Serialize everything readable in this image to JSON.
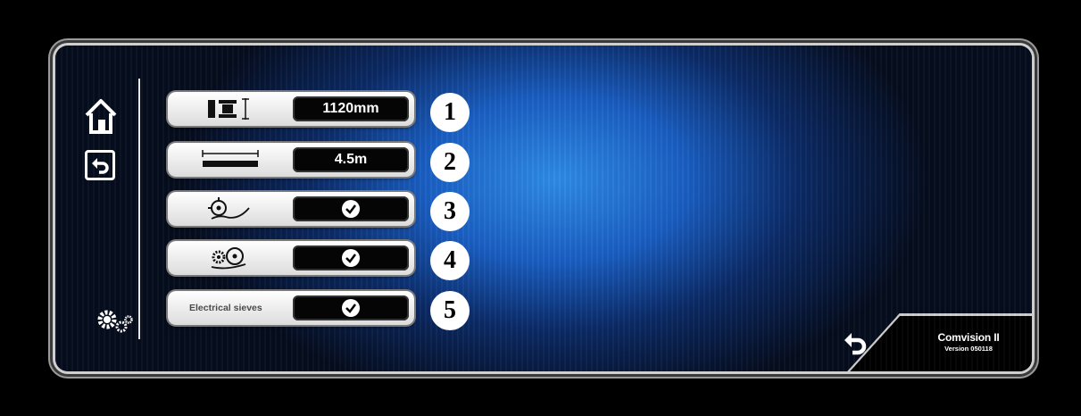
{
  "rows": [
    {
      "number": "1",
      "icon": "spacing-icon",
      "value": "1120mm",
      "type": "text"
    },
    {
      "number": "2",
      "icon": "width-icon",
      "value": "4.5m",
      "type": "text"
    },
    {
      "number": "3",
      "icon": "rotor-icon",
      "value": "",
      "type": "check"
    },
    {
      "number": "4",
      "icon": "gears-sieve-icon",
      "value": "",
      "type": "check"
    },
    {
      "number": "5",
      "label": "Electrical sieves",
      "value": "",
      "type": "check"
    }
  ],
  "brand": {
    "name": "Comvision II",
    "version": "Version 050118"
  },
  "colors": {
    "accent": "#1a5fc4",
    "frame": "#cfcfcf"
  }
}
